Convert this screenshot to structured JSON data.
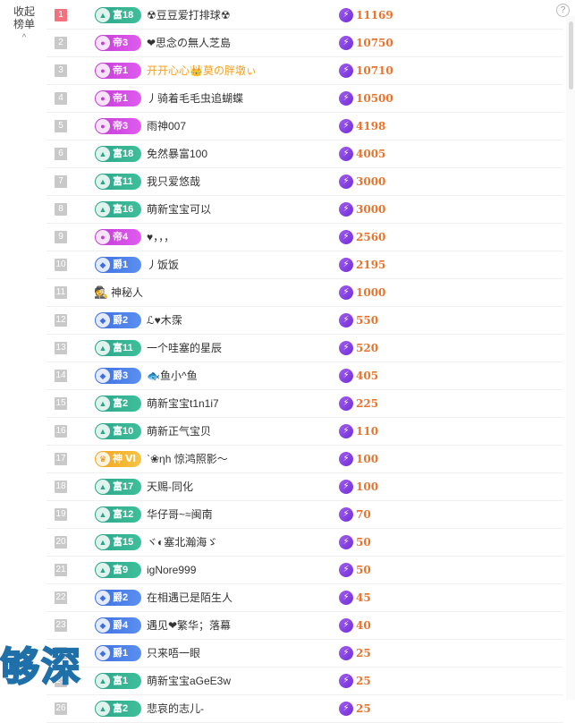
{
  "header": {
    "collapse_label_line1": "收起",
    "collapse_label_line2": "榜单",
    "collapse_chevron": "^",
    "help_symbol": "?"
  },
  "watermark_text": "够深",
  "rows": [
    {
      "rank": "1",
      "badge_type": "fu",
      "badge_emb": "▲",
      "badge_label": "富18",
      "name": "☢豆豆爱打排球☢",
      "score": "11169"
    },
    {
      "rank": "2",
      "badge_type": "di",
      "badge_emb": "●",
      "badge_label": "帝3",
      "name": "❤思念の無人芝島",
      "score": "10750"
    },
    {
      "rank": "3",
      "badge_type": "di",
      "badge_emb": "●",
      "badge_label": "帝1",
      "name": "开开心心👑莫の胖墩ぃ",
      "score": "10710",
      "name_color": "gold"
    },
    {
      "rank": "4",
      "badge_type": "di",
      "badge_emb": "●",
      "badge_label": "帝1",
      "name": "丿骑着毛毛虫追蝴蝶",
      "score": "10500"
    },
    {
      "rank": "5",
      "badge_type": "di",
      "badge_emb": "●",
      "badge_label": "帝3",
      "name": "雨神007",
      "score": "4198"
    },
    {
      "rank": "6",
      "badge_type": "fu",
      "badge_emb": "▲",
      "badge_label": "富18",
      "name": "免然暴富100",
      "score": "4005"
    },
    {
      "rank": "7",
      "badge_type": "fu",
      "badge_emb": "▲",
      "badge_label": "富11",
      "name": "我只爱悠哉",
      "score": "3000"
    },
    {
      "rank": "8",
      "badge_type": "fu",
      "badge_emb": "▲",
      "badge_label": "富16",
      "name": "萌新宝宝可以",
      "score": "3000"
    },
    {
      "rank": "9",
      "badge_type": "di",
      "badge_emb": "●",
      "badge_label": "帝4",
      "name": "♥，，，",
      "score": "2560"
    },
    {
      "rank": "10",
      "badge_type": "jue",
      "badge_emb": "◆",
      "badge_label": "爵1",
      "name": "丿饭饭",
      "score": "2195"
    },
    {
      "rank": "11",
      "badge_type": "mystery",
      "badge_emb": "🕵",
      "badge_label": "",
      "name": "神秘人",
      "score": "1000"
    },
    {
      "rank": "12",
      "badge_type": "jue",
      "badge_emb": "◆",
      "badge_label": "爵2",
      "name": "ℒ♥木霂",
      "score": "550"
    },
    {
      "rank": "13",
      "badge_type": "fu",
      "badge_emb": "▲",
      "badge_label": "富11",
      "name": "一个哇塞的星辰",
      "score": "520"
    },
    {
      "rank": "14",
      "badge_type": "jue",
      "badge_emb": "◆",
      "badge_label": "爵3",
      "name": "🐟鱼小^鱼",
      "score": "405"
    },
    {
      "rank": "15",
      "badge_type": "fu",
      "badge_emb": "▲",
      "badge_label": "富2",
      "name": "萌新宝宝t1n1i7",
      "score": "225"
    },
    {
      "rank": "16",
      "badge_type": "fu",
      "badge_emb": "▲",
      "badge_label": "富10",
      "name": "萌新正气宝贝",
      "score": "110"
    },
    {
      "rank": "17",
      "badge_type": "shen",
      "badge_emb": "♛",
      "badge_label": "神 Ⅵ",
      "name": "ˋ❀ηh 惊鸿照影～",
      "score": "100"
    },
    {
      "rank": "18",
      "badge_type": "fu",
      "badge_emb": "▲",
      "badge_label": "富17",
      "name": "天赐-同化",
      "score": "100"
    },
    {
      "rank": "19",
      "badge_type": "fu",
      "badge_emb": "▲",
      "badge_label": "富12",
      "name": "华仔哥~≈闽南",
      "score": "70"
    },
    {
      "rank": "20",
      "badge_type": "fu",
      "badge_emb": "▲",
      "badge_label": "富15",
      "name": "ヾ◐塞北瀚海ゞ",
      "score": "50"
    },
    {
      "rank": "21",
      "badge_type": "fu",
      "badge_emb": "▲",
      "badge_label": "富9",
      "name": "igNore999",
      "score": "50"
    },
    {
      "rank": "22",
      "badge_type": "jue",
      "badge_emb": "◆",
      "badge_label": "爵2",
      "name": "在相遇已是陌生人",
      "score": "45"
    },
    {
      "rank": "23",
      "badge_type": "jue",
      "badge_emb": "◆",
      "badge_label": "爵4",
      "name": "遇见❤繁华；落幕",
      "score": "40"
    },
    {
      "rank": "24",
      "badge_type": "jue",
      "badge_emb": "◆",
      "badge_label": "爵1",
      "name": "只来唔一眼",
      "score": "25"
    },
    {
      "rank": "25",
      "badge_type": "fu",
      "badge_emb": "▲",
      "badge_label": "富1",
      "name": "萌新宝宝aGeE3w",
      "score": "25"
    },
    {
      "rank": "26",
      "badge_type": "fu",
      "badge_emb": "▲",
      "badge_label": "富2",
      "name": "悲哀的志儿-",
      "score": "25"
    }
  ],
  "colors": {
    "rank_first": "#f4727f",
    "rank_default": "#c9c9c9",
    "score": "#e8732d",
    "fu": "#2aa58a",
    "di": "#c33bd5",
    "jue": "#3d6fe0",
    "shen": "#f4a31c"
  },
  "icons": {
    "score_icon": "lightning-bolt-icon",
    "collapse_icon": "chevron-up-icon",
    "help_icon": "question-circle-icon"
  }
}
